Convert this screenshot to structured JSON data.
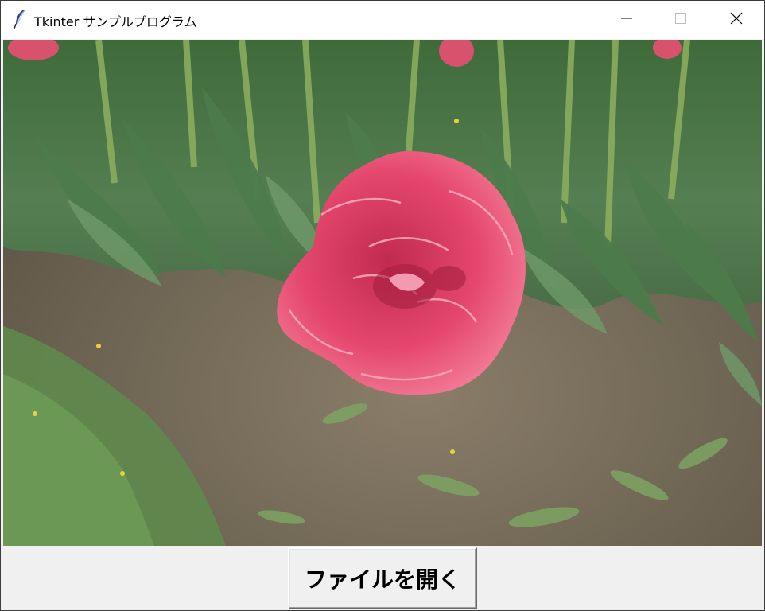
{
  "window": {
    "title": "Tkinter サンプルプログラム",
    "icon": "feather-icon",
    "controls": {
      "minimize_icon": "minimize-icon",
      "maximize_icon": "maximize-icon",
      "close_icon": "close-icon"
    }
  },
  "canvas": {
    "image_subject": "pink-tulip-photo"
  },
  "actions": {
    "open_file_label": "ファイルを開く"
  },
  "colors": {
    "titlebar_bg": "#ffffff",
    "window_bg": "#f0f0f0",
    "flower_pink": "#e5476d",
    "foliage_green": "#4f7a4e",
    "soil_brown": "#6b604f"
  }
}
